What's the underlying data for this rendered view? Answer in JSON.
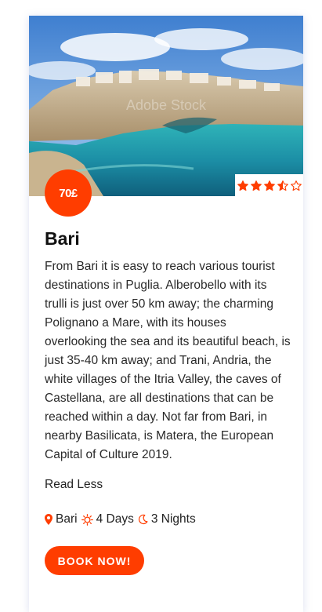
{
  "card": {
    "price": "70£",
    "rating": {
      "value": 3.5,
      "max": 5
    },
    "title": "Bari",
    "description": "From Bari it is easy to reach various tourist destinations in Puglia. Alberobello with its trulli is just over 50 km away; the charming Polignano a Mare, with its houses overlooking the sea and its beautiful beach, is just 35-40 km away; and Trani, Andria, the white villages of the Itria Valley, the caves of Castellana, are all destinations that can be reached within a day. Not far from Bari, in nearby Basilicata, is Matera, the European Capital of Culture 2019.",
    "read_less_label": "Read Less",
    "location": "Bari",
    "days": "4 Days",
    "nights": "3 Nights",
    "book_label": "BOOK NOW!",
    "watermark": "Adobe Stock"
  },
  "icons": {
    "location": "map-marker-icon",
    "days": "sun-icon",
    "nights": "moon-icon",
    "rating": "star-icon"
  },
  "colors": {
    "accent": "#ff3d00",
    "text": "#222222"
  }
}
